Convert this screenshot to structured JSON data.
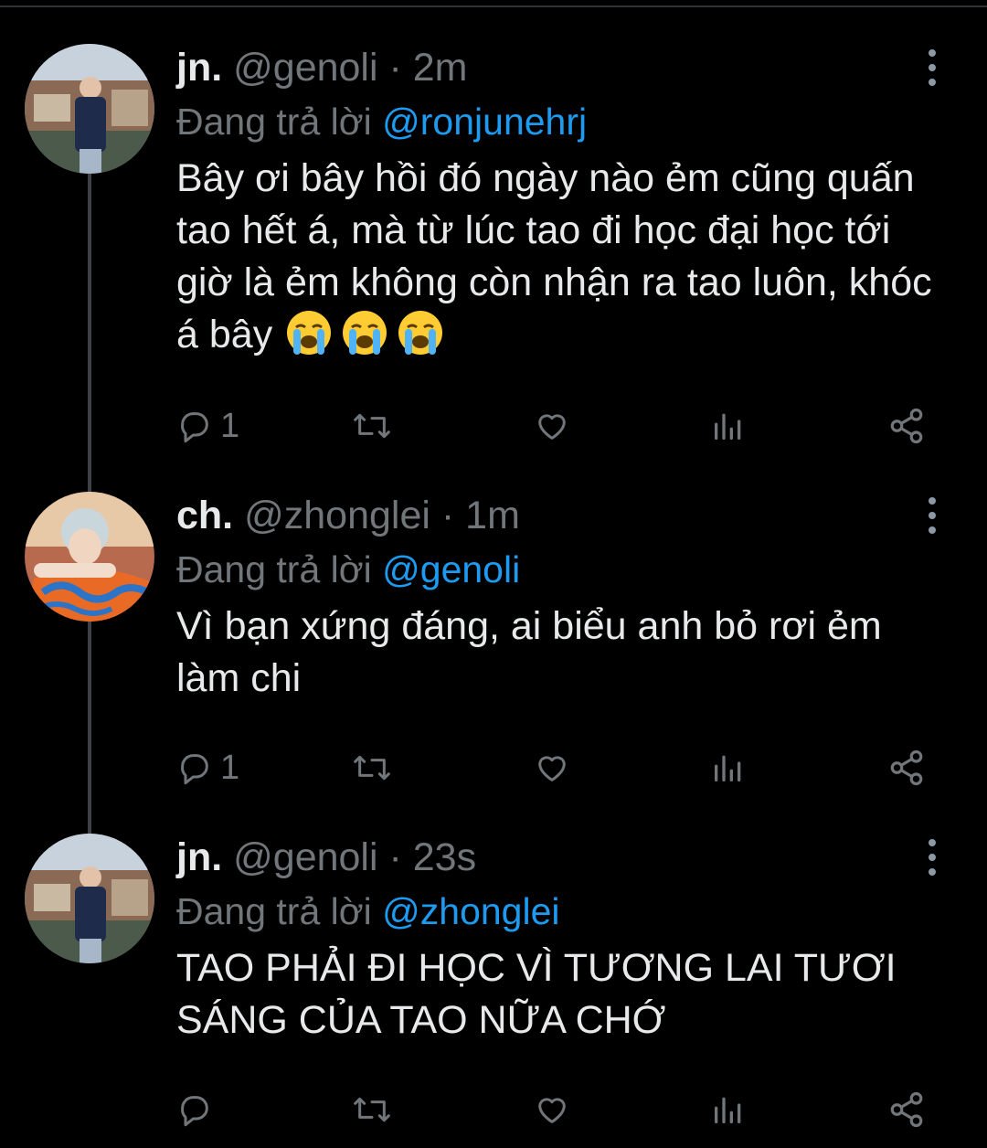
{
  "colors": {
    "background": "#000000",
    "text": "#e7e9ea",
    "muted": "#71767b",
    "accent": "#1d9bf0",
    "thread_line": "#3d4146"
  },
  "tweets": [
    {
      "name": "jn.",
      "handle": "@genoli",
      "time": "· 2m",
      "reply_prefix": "Đang trả lời",
      "reply_to": "@ronjunehrj",
      "text": "Bây ơi bây hồi đó ngày nào ẻm cũng quấn tao hết á, mà từ lúc tao đi học đại học tới giờ là ẻm không còn nhận ra tao luôn, khóc á bây",
      "emoji": "loudly-crying-face-icon ×3",
      "reply_count": "1"
    },
    {
      "name": "ch.",
      "handle": "@zhonglei",
      "time": "· 1m",
      "reply_prefix": "Đang trả lời",
      "reply_to": "@genoli",
      "text": "Vì bạn xứng đáng, ai biểu anh bỏ rơi ẻm làm chi",
      "reply_count": "1"
    },
    {
      "name": "jn.",
      "handle": "@genoli",
      "time": "· 23s",
      "reply_prefix": "Đang trả lời",
      "reply_to": "@zhonglei",
      "text": "TAO PHẢI ĐI HỌC VÌ TƯƠNG LAI TƯƠI SÁNG CỦA TAO NỮA CHỚ",
      "reply_count": ""
    }
  ],
  "icons": [
    "reply-icon",
    "retweet-icon",
    "like-icon",
    "analytics-icon",
    "share-icon",
    "more-icon"
  ]
}
